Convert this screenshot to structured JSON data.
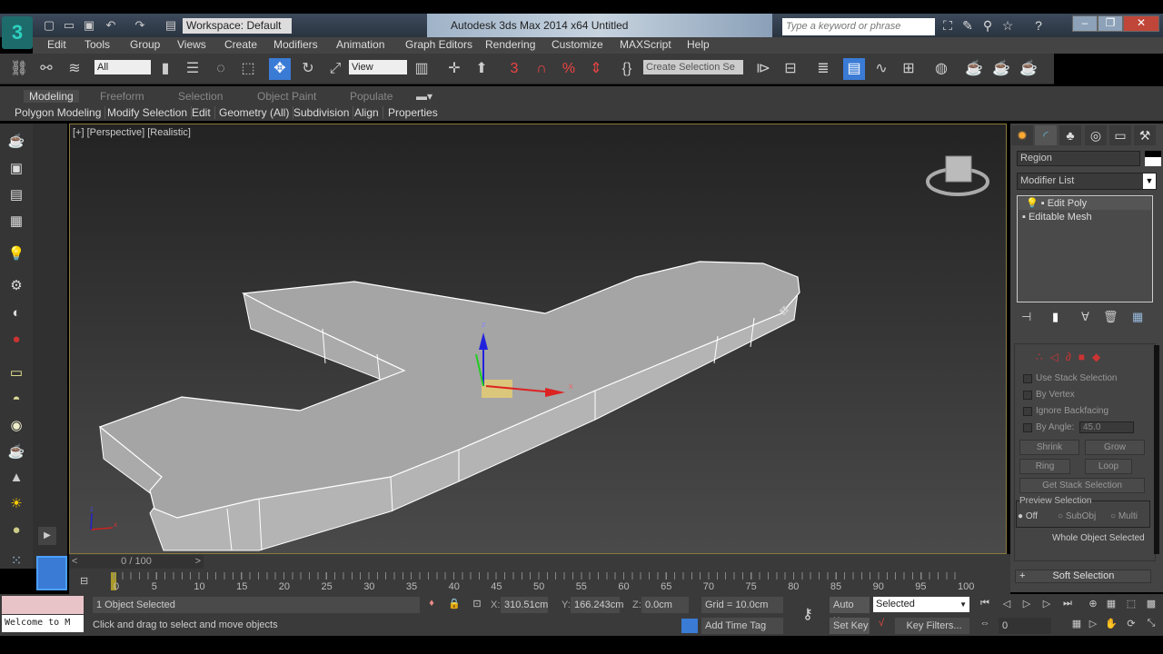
{
  "titlebar": {
    "title": "Autodesk 3ds Max  2014 x64     Untitled",
    "workspace": "Workspace: Default",
    "search_placeholder": "Type a keyword or phrase"
  },
  "menu": [
    "Edit",
    "Tools",
    "Group",
    "Views",
    "Create",
    "Modifiers",
    "Animation",
    "Graph Editors",
    "Rendering",
    "Customize",
    "MAXScript",
    "Help"
  ],
  "toolbar": {
    "selection_filter": "All",
    "ref_coord": "View",
    "snap_angle": "3",
    "named_selection": "Create Selection Se"
  },
  "ribbon": {
    "tabs": [
      "Modeling",
      "Freeform",
      "Selection",
      "Object Paint",
      "Populate"
    ],
    "panels": [
      "Polygon Modeling",
      "Modify Selection",
      "Edit",
      "Geometry (All)",
      "Subdivision",
      "Align",
      "Properties"
    ]
  },
  "viewport": {
    "label": "[+] [Perspective] [Realistic]",
    "gizmo": {
      "x": "x",
      "z": "z"
    },
    "axis": {
      "x": "x",
      "z": "z"
    }
  },
  "command_panel": {
    "name_field": "Region",
    "modifier_list": "Modifier List",
    "stack": [
      "Edit Poly",
      "Editable Mesh"
    ],
    "selection": {
      "use_stack": "Use Stack Selection",
      "by_vertex": "By Vertex",
      "ignore_backfacing": "Ignore Backfacing",
      "by_angle": "By Angle:",
      "angle_value": "45.0",
      "shrink": "Shrink",
      "grow": "Grow",
      "ring": "Ring",
      "loop": "Loop",
      "get_stack": "Get Stack Selection",
      "preview_title": "Preview Selection",
      "preview_options": [
        "Off",
        "SubObj",
        "Multi"
      ],
      "preview_selected": "Off",
      "status": "Whole Object Selected"
    },
    "soft_selection": "Soft Selection",
    "soft_plus": "+"
  },
  "timeline": {
    "position": "0 / 100",
    "prev": "<",
    "next": ">",
    "ticks": [
      "0",
      "5",
      "10",
      "15",
      "20",
      "25",
      "30",
      "35",
      "40",
      "45",
      "50",
      "55",
      "60",
      "65",
      "70",
      "75",
      "80",
      "85",
      "90",
      "95",
      "100"
    ]
  },
  "status": {
    "maxscript": "Welcome to M",
    "selected": "1 Object Selected",
    "prompt": "Click and drag to select and move objects",
    "x_label": "X:",
    "x": "310.51cm",
    "y_label": "Y:",
    "y": "166.243cm",
    "z_label": "Z:",
    "z": "0.0cm",
    "grid": "Grid = 10.0cm",
    "time_tag": "Add Time Tag",
    "auto_key": "Auto Key",
    "set_key": "Set Key",
    "key_mode": "Selected",
    "key_filters": "Key Filters...",
    "frame": "0"
  }
}
